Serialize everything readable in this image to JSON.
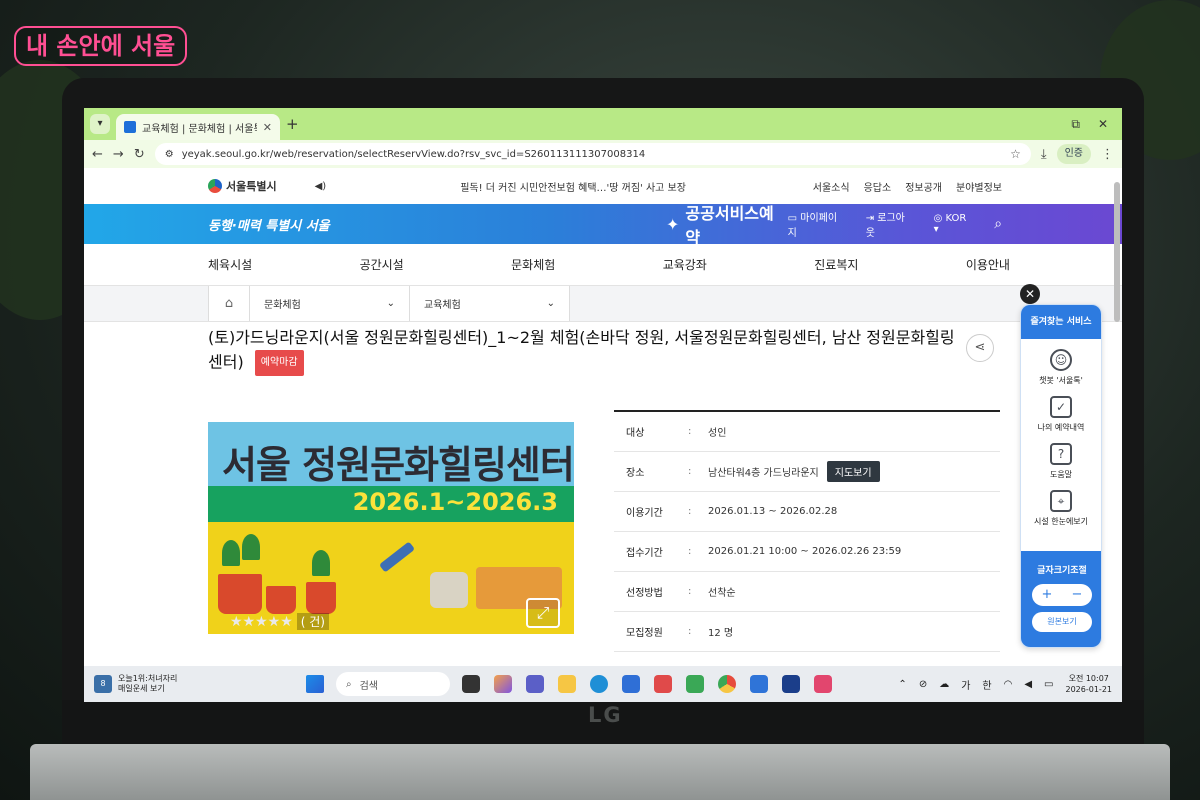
{
  "watermark": "내 손안에 서울",
  "brand": "LG",
  "browser": {
    "tab_title": "교육체험 | 문화체험 | 서울특별시",
    "url": "yeyak.seoul.go.kr/web/reservation/selectReservView.do?rsv_svc_id=S260113111307008314",
    "account_label": "인증"
  },
  "site": {
    "logo": "서울특별시",
    "notice": "필독! 더 커진 시민안전보험 혜택…'땅 꺼짐' 사고 보장",
    "util_links": [
      "서울소식",
      "응답소",
      "정보공개",
      "분야별정보"
    ],
    "slogan": "동행·매력 특별시 서울",
    "service_title": "공공서비스예약",
    "header_links": {
      "mypage": "마이페이지",
      "logout": "로그아웃",
      "lang": "KOR"
    },
    "nav": [
      "체육시설",
      "공간시설",
      "문화체험",
      "교육강좌",
      "진료복지",
      "이용안내"
    ],
    "breadcrumb": [
      "문화체험",
      "교육체험"
    ]
  },
  "detail": {
    "title": "(토)가드닝라운지(서울 정원문화힐링센터)_1~2월 체험(손바닥 정원, 서울정원문화힐링센터, 남산 정원문화힐링센터)",
    "status": "예약마감",
    "poster_title": "서울 정원문화힐링센터",
    "poster_dates": "2026.1~2026.3",
    "rating_count": "( 건)",
    "info": [
      {
        "key": "대상",
        "value": "성인"
      },
      {
        "key": "장소",
        "value": "남산타워4층 가드닝라운지",
        "button": "지도보기"
      },
      {
        "key": "이용기간",
        "value": "2026.01.13 ~ 2026.02.28"
      },
      {
        "key": "접수기간",
        "value": "2026.01.21 10:00 ~ 2026.02.26 23:59"
      },
      {
        "key": "선정방법",
        "value": "선착순"
      },
      {
        "key": "모집정원",
        "value": "12 명"
      }
    ]
  },
  "quick_menu": {
    "title": "즐겨찾는 서비스",
    "items": [
      "챗봇 '서울톡'",
      "나의 예약내역",
      "도움말",
      "시설 한눈에보기"
    ],
    "font_title": "글자크기조절",
    "plus": "+",
    "minus": "−",
    "reset": "원본보기"
  },
  "taskbar": {
    "weather_line1": "오늘1위:처녀자리",
    "weather_line2": "매일운세 보기",
    "weather_badge": "8",
    "search": "검색",
    "ime_ga": "가",
    "ime_han": "한",
    "time": "오전 10:07",
    "date": "2026-01-21"
  },
  "colors": {
    "accent": "#2d7be0",
    "status_closed": "#e74b4b",
    "banner_start": "#22a7e8",
    "banner_end": "#6b48d2",
    "tab_green": "#b8e986"
  }
}
